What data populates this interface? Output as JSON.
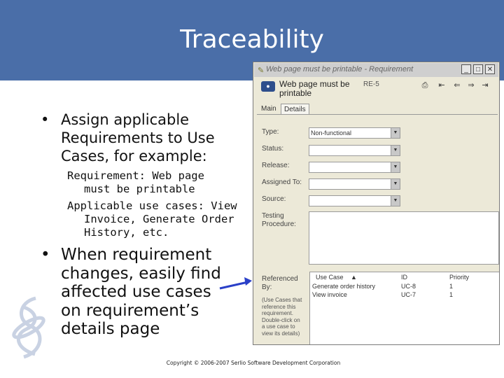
{
  "slide": {
    "title": "Traceability",
    "bullet_marker": "•",
    "bullet1": "Assign applicable Requirements to Use Cases, for example:",
    "example_line1": "Requirement: Web page",
    "example_line2": "must be printable",
    "example_line3": "Applicable use cases: View",
    "example_line4": "Invoice, Generate Order",
    "example_line5": "History, etc.",
    "bullet2": "When requirement changes, easily find affected use cases on requirement’s details page",
    "footer": "Copyright © 2006-2007 Serlio Software Development Corporation"
  },
  "colors": {
    "banner": "#4a6ea8",
    "arrow": "#2a40c8"
  },
  "dialog": {
    "title": "Web page must be printable - Requirement",
    "window_buttons": {
      "minimize": "_",
      "maximize": "□",
      "close": "✕"
    },
    "header_name": "Web page must be printable",
    "header_id": "RE-5",
    "toolbar": {
      "print": "⎙",
      "first": "⇤",
      "prev": "⇐",
      "next": "⇒",
      "last": "⇥"
    },
    "tabs": [
      "Main",
      "Details"
    ],
    "fields": [
      {
        "label": "Type:",
        "value": "Non-functional"
      },
      {
        "label": "Status:",
        "value": ""
      },
      {
        "label": "Release:",
        "value": ""
      },
      {
        "label": "Assigned To:",
        "value": ""
      },
      {
        "label": "Source:",
        "value": ""
      }
    ],
    "testing_label": "Testing Procedure:",
    "referenced_label": "Referenced By:",
    "help_text": "(Use Cases that reference this requirement. Double-click on a use case to view its details)",
    "grid": {
      "columns": [
        "Use Case",
        "ID",
        "Priority"
      ],
      "rows": [
        [
          "Generate order history",
          "UC-8",
          "1"
        ],
        [
          "View invoice",
          "UC-7",
          "1"
        ]
      ]
    }
  }
}
